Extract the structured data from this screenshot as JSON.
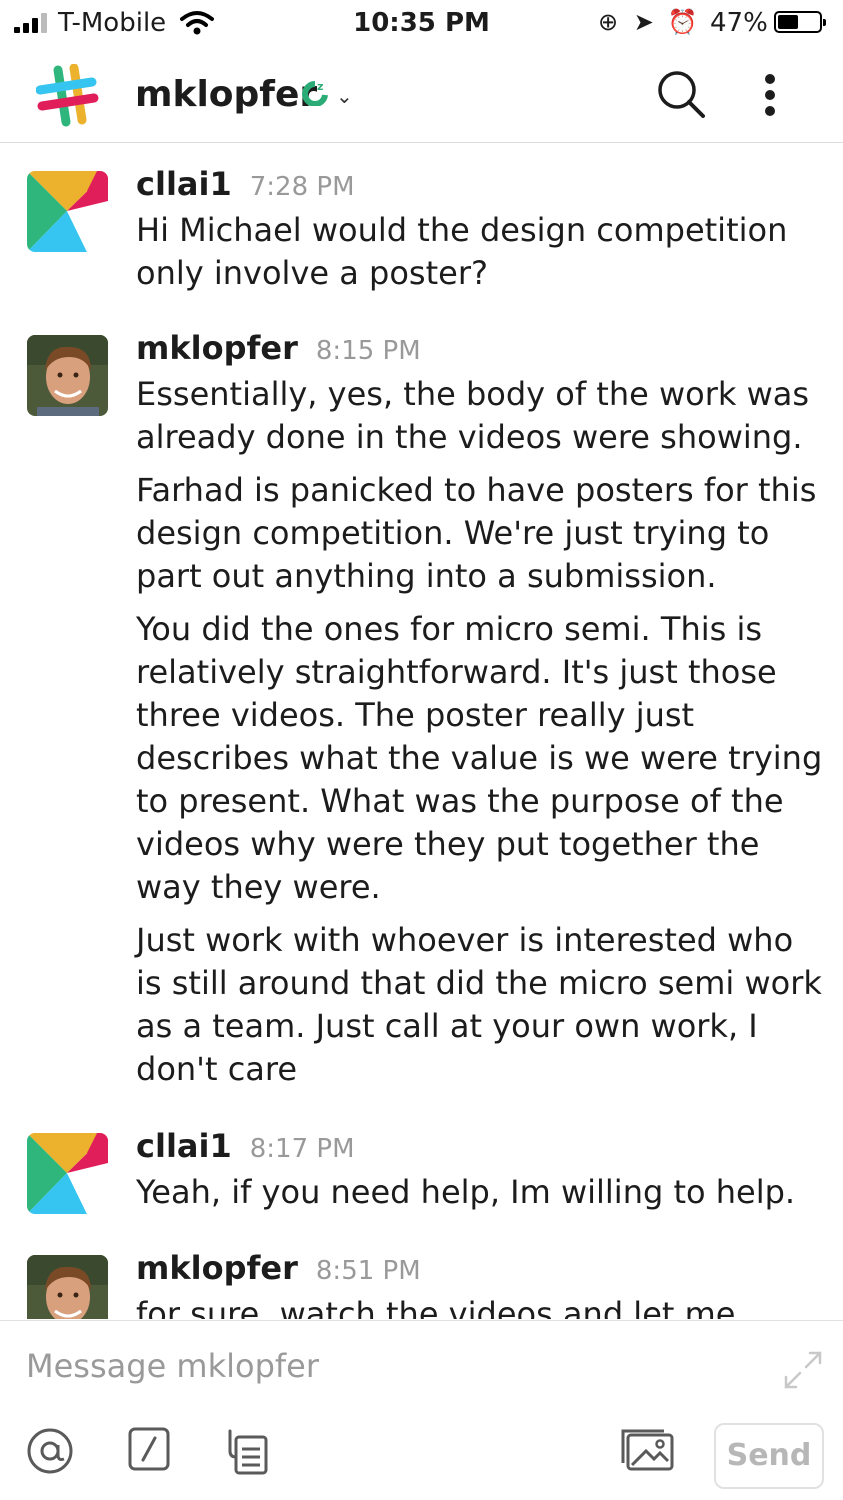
{
  "status_bar": {
    "carrier": "T-Mobile",
    "time": "10:35 PM",
    "battery": "47%",
    "battery_level": 0.47
  },
  "header": {
    "title": "mklopfer",
    "presence_icon": "away-zz-icon"
  },
  "messages": [
    {
      "author": "cllai1",
      "time": "7:28 PM",
      "avatar": "default-avatar",
      "paragraphs": [
        "Hi Michael would the design competition only involve a poster?"
      ]
    },
    {
      "author": "mklopfer",
      "time": "8:15 PM",
      "avatar": "user-photo",
      "paragraphs": [
        "Essentially, yes, the body of the work was already done in the videos were showing.",
        "Farhad is panicked to have posters for this design competition. We're just trying to part out anything into a submission.",
        "You did the ones for micro semi. This is relatively straightforward. It's just those three videos.  The poster really just describes what the value is we were trying to present. What was the purpose of the videos why were they put together the way they were.",
        "Just work with whoever is interested who is still around that did the micro semi work as a team.  Just call at your own work, I don't care"
      ]
    },
    {
      "author": "cllai1",
      "time": "8:17 PM",
      "avatar": "default-avatar",
      "paragraphs": [
        "Yeah, if you need help, Im willing to help."
      ]
    },
    {
      "author": "mklopfer",
      "time": "8:51 PM",
      "avatar": "user-photo",
      "paragraphs": [
        "for sure, watch the videos and let me know"
      ]
    }
  ],
  "composer": {
    "placeholder": "Message mklopfer",
    "send_label": "Send"
  },
  "colors": {
    "slack_yellow": "#ECB22E",
    "slack_red": "#E01E5A",
    "slack_green": "#2EB67D",
    "slack_blue": "#36C5F0",
    "presence_green": "#2BAC76"
  }
}
